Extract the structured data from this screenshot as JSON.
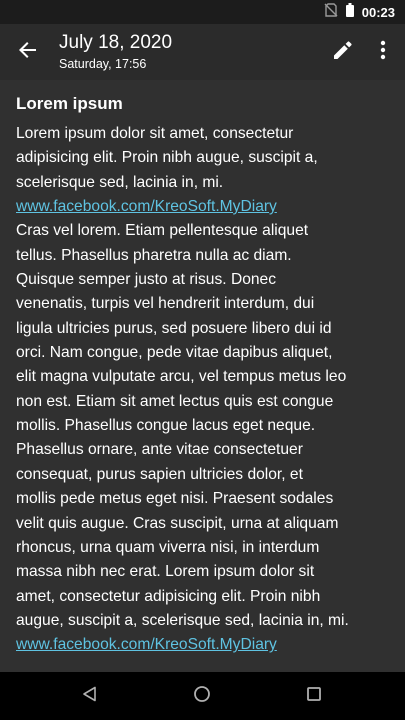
{
  "status_bar": {
    "time": "00:23",
    "icons": [
      "no-sim-icon",
      "battery-icon"
    ]
  },
  "app_bar": {
    "date": "July 18, 2020",
    "subtitle": "Saturday, 17:56",
    "icons": [
      "back-arrow-icon",
      "edit-pencil-icon",
      "more-vert-icon"
    ]
  },
  "note": {
    "title": "Lorem ipsum",
    "lines": [
      {
        "text": "Lorem ipsum dolor sit amet, consectetur",
        "link": false
      },
      {
        "text": "adipisicing elit. Proin nibh augue, suscipit a,",
        "link": false
      },
      {
        "text": "scelerisque sed, lacinia in, mi.",
        "link": false
      },
      {
        "text": "www.facebook.com/KreoSoft.MyDiary",
        "link": true
      },
      {
        "text": "Cras vel lorem. Etiam pellentesque aliquet",
        "link": false
      },
      {
        "text": "tellus. Phasellus pharetra nulla ac diam.",
        "link": false
      },
      {
        "text": "Quisque semper justo at risus. Donec",
        "link": false
      },
      {
        "text": "venenatis, turpis vel hendrerit interdum, dui",
        "link": false
      },
      {
        "text": "ligula ultricies purus, sed posuere libero dui id",
        "link": false
      },
      {
        "text": "orci. Nam congue, pede vitae dapibus aliquet,",
        "link": false
      },
      {
        "text": "elit magna vulputate arcu, vel tempus metus leo",
        "link": false
      },
      {
        "text": "non est. Etiam sit amet lectus quis est congue",
        "link": false
      },
      {
        "text": "mollis. Phasellus congue lacus eget neque.",
        "link": false
      },
      {
        "text": "Phasellus ornare, ante vitae consectetuer",
        "link": false
      },
      {
        "text": "consequat, purus sapien ultricies dolor, et",
        "link": false
      },
      {
        "text": "mollis pede metus eget nisi. Praesent sodales",
        "link": false
      },
      {
        "text": "velit quis augue. Cras suscipit, urna at aliquam",
        "link": false
      },
      {
        "text": "rhoncus, urna quam viverra nisi, in interdum",
        "link": false
      },
      {
        "text": "massa nibh nec erat. Lorem ipsum dolor sit",
        "link": false
      },
      {
        "text": "amet, consectetur adipisicing elit. Proin nibh",
        "link": false
      },
      {
        "text": "augue, suscipit a, scelerisque sed, lacinia in, mi.",
        "link": false
      },
      {
        "text": "www.facebook.com/KreoSoft.MyDiary",
        "link": true
      }
    ]
  },
  "nav_bar": {
    "icons": [
      "nav-back-icon",
      "nav-home-icon",
      "nav-recents-icon"
    ]
  },
  "colors": {
    "background": "#303030",
    "app_bar": "#2b2b2b",
    "status_bar": "#1c1c1c",
    "nav_bar": "#000000",
    "text": "#ffffff",
    "link": "#5fc3e2"
  }
}
